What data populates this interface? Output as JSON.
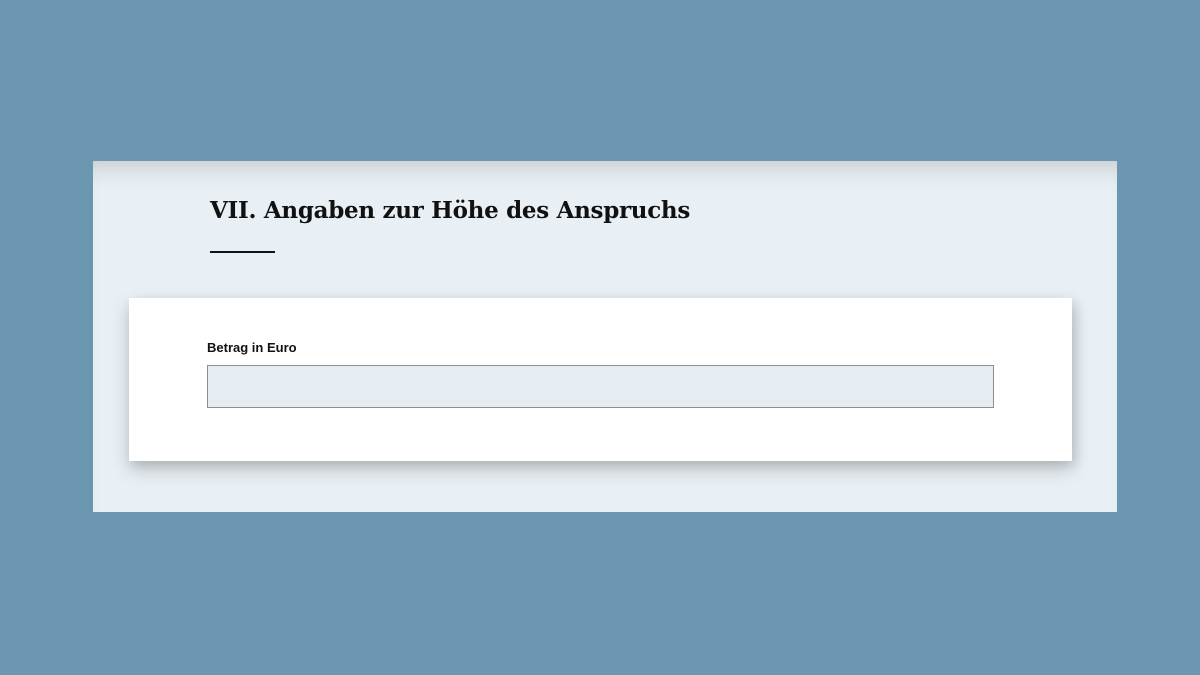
{
  "section": {
    "title": "VII. Angaben zur Höhe des Anspruchs"
  },
  "form": {
    "amount": {
      "label": "Betrag in Euro",
      "value": "",
      "placeholder": ""
    }
  },
  "colors": {
    "page_background": "#6b96b0",
    "panel_background": "#e9f0f5",
    "card_background": "#ffffff",
    "input_background": "#e5edf3",
    "input_border": "#8e8e8e",
    "text": "#111111"
  }
}
